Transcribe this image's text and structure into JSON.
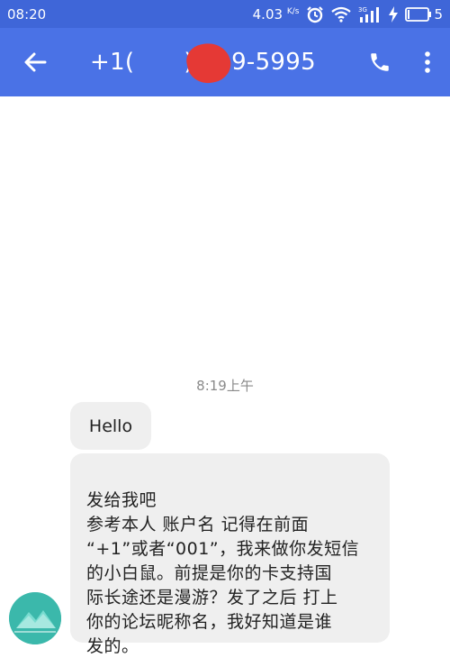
{
  "status_bar": {
    "time": "08:20",
    "speed_value": "4.03",
    "speed_unit": "K/s",
    "network_label": "3G",
    "battery_level": "5"
  },
  "app_bar": {
    "back_icon": "arrow-left-icon",
    "contact_prefix": "+1(",
    "contact_suffix": ") 219-5995",
    "call_icon": "phone-icon",
    "menu_icon": "more-vertical-icon"
  },
  "conversation": {
    "timestamp": "8:19上午",
    "messages": [
      {
        "text": "Hello"
      },
      {
        "text": "发给我吧\n参考本人 账户名 记得在前面\n“+1”或者“001”，我来做你发短信\n的小白鼠。前提是你的卡支持国\n际长途还是漫游？发了之后 打上\n你的论坛昵称名，我好知道是谁\n发的。"
      }
    ]
  },
  "colors": {
    "status_bar": "#3f66d8",
    "app_bar": "#4a72e6",
    "bubble": "#efefef",
    "redaction": "#e53935",
    "avatar": "#3bb8ab"
  }
}
